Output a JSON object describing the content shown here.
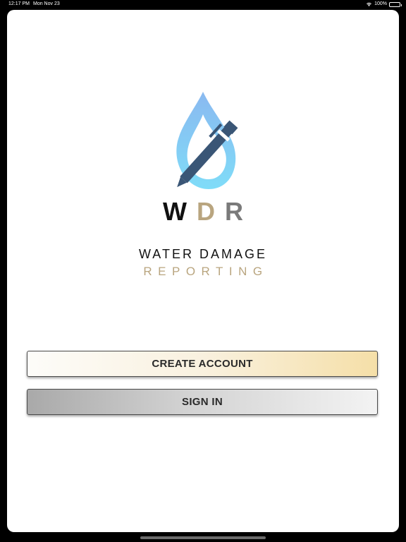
{
  "status_bar": {
    "time": "12:17 PM",
    "date": "Mon Nov 23",
    "battery": "100%"
  },
  "logo": {
    "icon": "water-drop-pen-icon",
    "letters": [
      {
        "char": "W",
        "color": "#111111"
      },
      {
        "char": "D",
        "color": "#b9a57f"
      },
      {
        "char": "R",
        "color": "#7a7a7a"
      }
    ],
    "tagline_line1": "WATER DAMAGE",
    "tagline_line2": "REPORTING"
  },
  "buttons": {
    "create_account": "CREATE ACCOUNT",
    "sign_in": "SIGN IN"
  },
  "colors": {
    "drop_light": "#7fd3f7",
    "drop_top": "#8ab9f0",
    "pen": "#3a5676",
    "gold": "#b9a57f"
  }
}
